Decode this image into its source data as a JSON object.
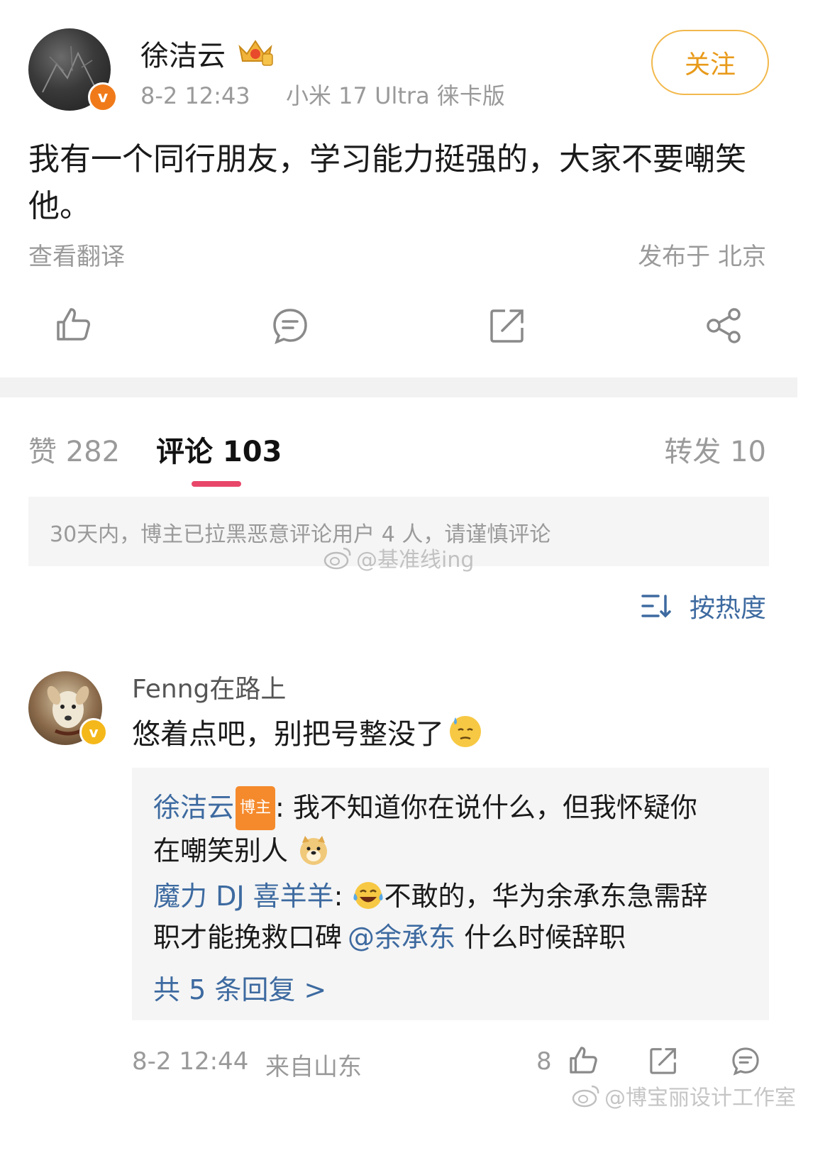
{
  "post": {
    "author": "徐洁云",
    "time": "8-2 12:43",
    "device": "小米 17 Ultra 徕卡版",
    "follow_label": "关注",
    "text": "我有一个同行朋友，学习能力挺强的，大家不要嘲笑他。",
    "translate_label": "查看翻译",
    "location": "发布于 北京"
  },
  "tabs": {
    "likes": "赞 282",
    "comments": "评论 103",
    "reposts": "转发 10"
  },
  "notice": "30天内，博主已拉黑恶意评论用户 4 人，请谨慎评论",
  "sort": {
    "label": "按热度"
  },
  "comment": {
    "author": "Fenng在路上",
    "text": "悠着点吧，别把号整没了",
    "replies": [
      {
        "author": "徐洁云",
        "tag": "博主",
        "text_line1": ": 我不知道你在说什么，但我怀疑你",
        "text_line2": "在嘲笑别人"
      },
      {
        "author": "魔力 DJ 喜羊羊",
        "text_line1": "不敢的，华为余承东急需辞",
        "text_line2a": "职才能挽救口碑",
        "mention": "@余承东",
        "text_line2b": " 什么时候辞职"
      }
    ],
    "more_replies": "共 5 条回复 >",
    "time": "8-2 12:44",
    "from": "来自山东",
    "like_count": "8"
  },
  "watermarks": {
    "center": "@基准线ing",
    "bottom": "@博宝丽设计工作室"
  },
  "colors": {
    "accent_orange": "#e89a1a",
    "link_blue": "#3d6aa0",
    "tab_underline": "#e8476a",
    "verified_badge": "#f07a1a",
    "verified_badge_yellow": "#f5b81a"
  },
  "icons": [
    "verified-v-icon",
    "crown-badge-icon",
    "like-icon",
    "comment-icon",
    "repost-icon",
    "share-icon",
    "sort-icon",
    "sweat-emoji-icon",
    "doge-emoji-icon",
    "laugh-cry-emoji-icon",
    "weibo-logo-icon"
  ]
}
